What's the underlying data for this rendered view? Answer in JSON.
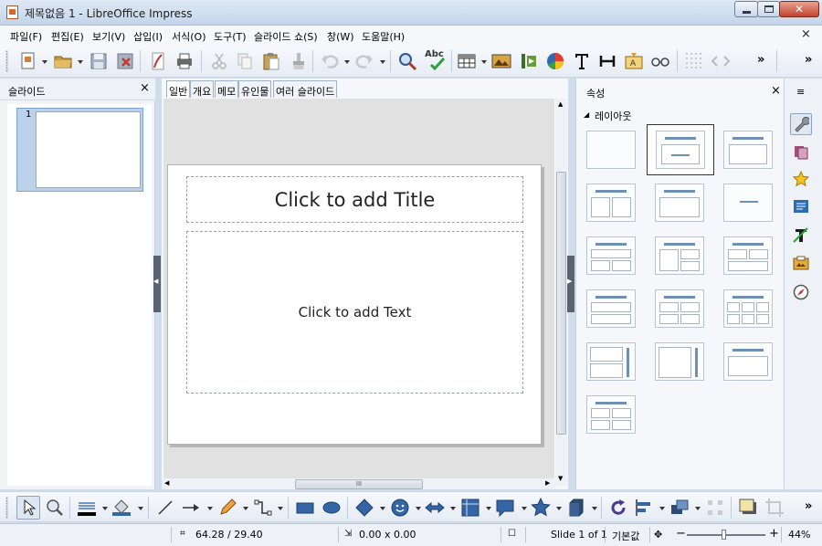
{
  "window": {
    "title": "제목없음 1 - LibreOffice Impress"
  },
  "menu": {
    "items": [
      "파일(F)",
      "편집(E)",
      "보기(V)",
      "삽입(I)",
      "서식(O)",
      "도구(T)",
      "슬라이드 쇼(S)",
      "창(W)",
      "도움말(H)"
    ],
    "close_glyph": "×"
  },
  "toolbar_standard": {
    "tools": [
      "new",
      "open",
      "save",
      "export",
      "export-pdf",
      "print",
      "cut",
      "copy",
      "paste",
      "clone-formatting",
      "undo",
      "redo",
      "find-replace",
      "spelling",
      "table",
      "image",
      "media",
      "chart",
      "text-box",
      "insert-field",
      "fontwork",
      "special-character",
      "grid",
      "helplines"
    ],
    "spelling_label": "Abc",
    "overflow": "»",
    "overflow_right": "»"
  },
  "slides_pane": {
    "title": "슬라이드",
    "close_glyph": "×",
    "slides": [
      {
        "number": "1"
      }
    ]
  },
  "view_tabs": [
    "일반",
    "개요",
    "메모",
    "유인물",
    "여러 슬라이드"
  ],
  "slide": {
    "title_placeholder": "Click to add Title",
    "body_placeholder": "Click to add Text"
  },
  "scroll": {
    "hthumb_grip": "III"
  },
  "properties": {
    "title": "속성",
    "close_glyph": "×",
    "section_title": "레이아웃",
    "section_toggle": "◢",
    "layouts": [
      "blank",
      "title-content",
      "title-only",
      "centered-text",
      "title-2-content",
      "title-content-2",
      "title-2-content-content",
      "title-content-over-content",
      "title-2-content-over-content",
      "title-4-content",
      "title-6-content",
      "vertical-title-text",
      "vertical-title-text-chart",
      "vertical-text",
      "title-4-boxes"
    ],
    "selected_layout": "title-content"
  },
  "sidebar": {
    "menu_glyph": "≡",
    "icons": [
      "properties-icon",
      "slide-transition-icon",
      "custom-animation-icon",
      "master-slides-icon",
      "styles-icon",
      "gallery-icon",
      "navigator-icon"
    ]
  },
  "toolbar_drawing": {
    "tools": [
      "select",
      "zoom",
      "line-color",
      "fill-color",
      "line",
      "arrow-line",
      "freeform",
      "connector",
      "rectangle",
      "ellipse",
      "basic-shapes",
      "symbol-shapes",
      "block-arrows",
      "flowchart",
      "callouts",
      "stars",
      "3d-objects",
      "rotate",
      "align",
      "arrange",
      "distribute",
      "shadow",
      "crop"
    ],
    "overflow": "»"
  },
  "statusbar": {
    "position": "64.28 / 29.40",
    "size": "0.00 x 0.00",
    "slide_info": "Slide 1 of 1",
    "master": "기본값",
    "zoom": "44%",
    "zoom_minus": "−",
    "zoom_plus": "+"
  },
  "colors": {
    "accent": "#6f8fb3",
    "titlebar": "#c4d5ea",
    "line_color": "#000000",
    "fill_color": "#3465a4"
  }
}
